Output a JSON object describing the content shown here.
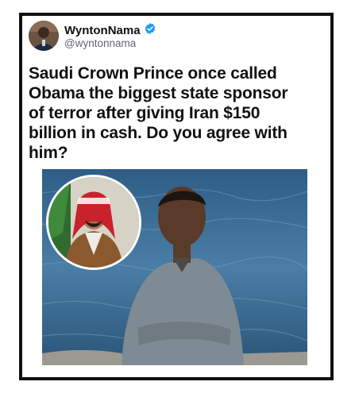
{
  "tweet": {
    "display_name": "WyntonNama",
    "handle": "@wyntonnama",
    "verified_icon": "verified-badge-icon",
    "text": "Saudi Crown Prince once called Obama the biggest state sponsor of terror after giving Iran $150 billion in cash. Do you agree with him?"
  },
  "colors": {
    "verified_blue": "#1d9bf0",
    "frame_border": "#111111",
    "text": "#111111",
    "handle_gray": "#5b6670",
    "sea_blue": "#3f6f95"
  }
}
